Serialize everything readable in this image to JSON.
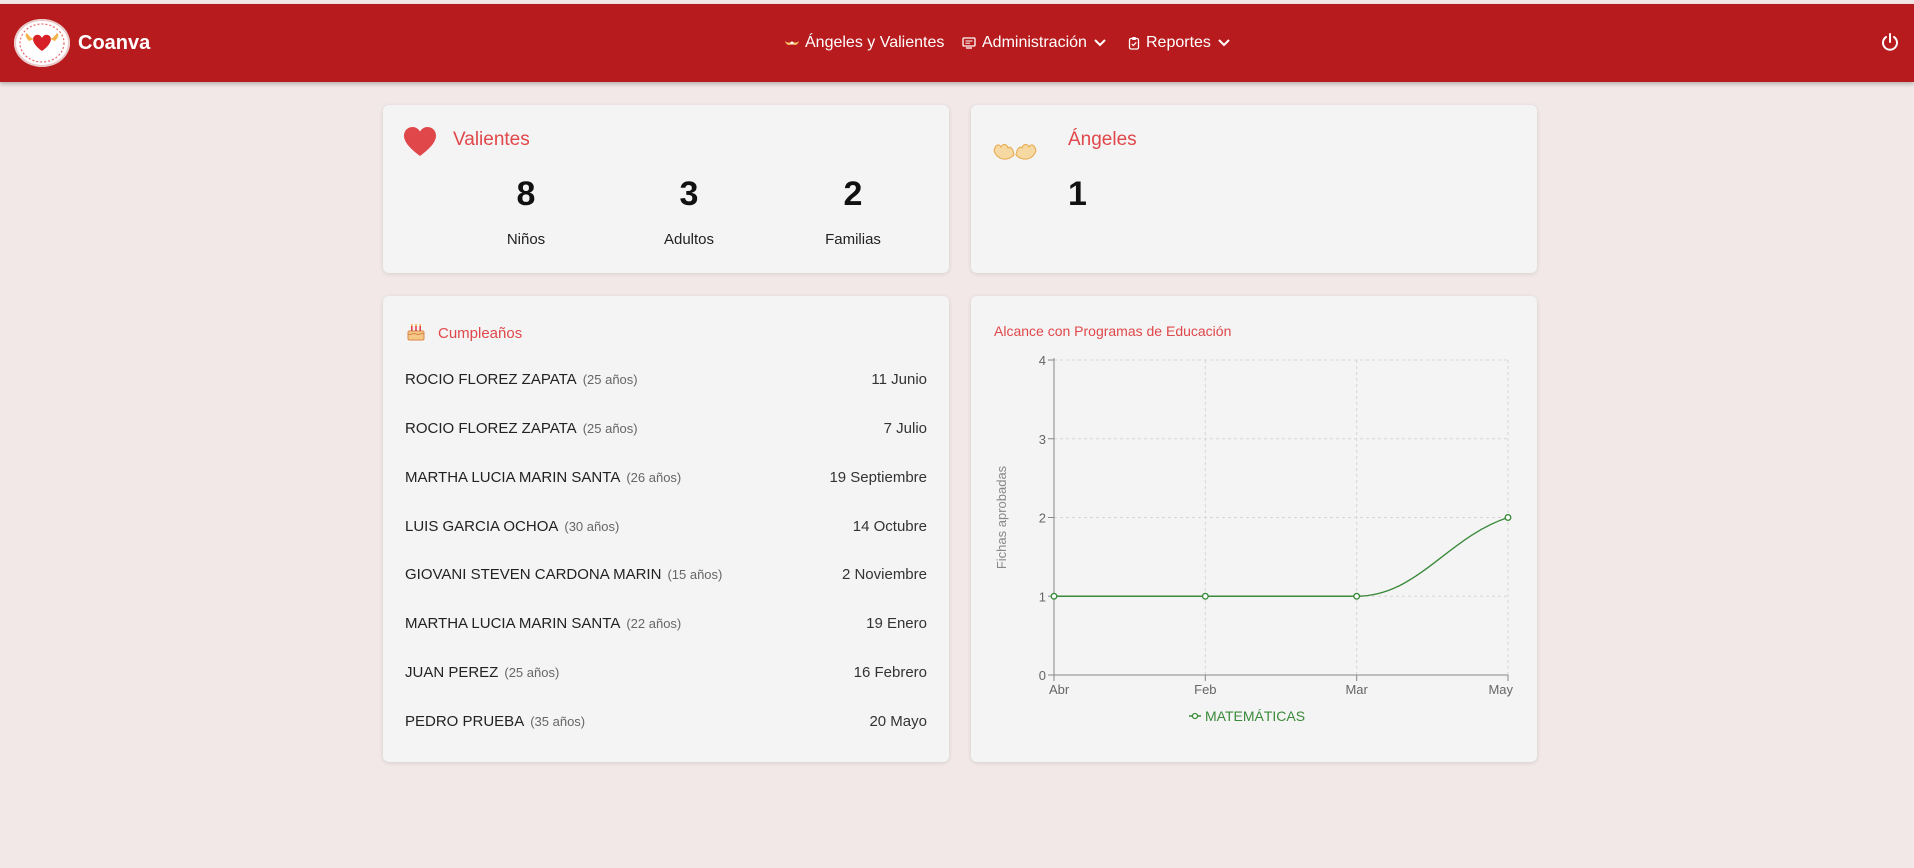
{
  "brand": {
    "name": "Coanva"
  },
  "nav": {
    "angeles_valientes": "Ángeles y Valientes",
    "administracion": "Administración",
    "reportes": "Reportes"
  },
  "colors": {
    "topbar": "#b81b1e",
    "accent": "#e0474a",
    "series_green": "#3a8a3a"
  },
  "valientes": {
    "title": "Valientes",
    "stats": [
      {
        "value": "8",
        "label": "Niños"
      },
      {
        "value": "3",
        "label": "Adultos"
      },
      {
        "value": "2",
        "label": "Familias"
      }
    ]
  },
  "angeles": {
    "title": "Ángeles",
    "value": "1"
  },
  "birthdays": {
    "title": "Cumpleaños",
    "items": [
      {
        "name": "ROCIO FLOREZ ZAPATA",
        "age": "(25 años)",
        "date": "11 Junio"
      },
      {
        "name": "ROCIO FLOREZ ZAPATA",
        "age": "(25 años)",
        "date": "7 Julio"
      },
      {
        "name": "MARTHA LUCIA MARIN SANTA",
        "age": "(26 años)",
        "date": "19 Septiembre"
      },
      {
        "name": "LUIS GARCIA OCHOA",
        "age": "(30 años)",
        "date": "14 Octubre"
      },
      {
        "name": "GIOVANI STEVEN CARDONA MARIN",
        "age": "(15 años)",
        "date": "2 Noviembre"
      },
      {
        "name": "MARTHA LUCIA MARIN SANTA",
        "age": "(22 años)",
        "date": "19 Enero"
      },
      {
        "name": "JUAN PEREZ",
        "age": "(25 años)",
        "date": "16 Febrero"
      },
      {
        "name": "PEDRO PRUEBA",
        "age": "(35 años)",
        "date": "20 Mayo"
      }
    ]
  },
  "chart_data": {
    "type": "line",
    "title": "Alcance con Programas de Educación",
    "xlabel": "",
    "ylabel": "Fichas aprobadas",
    "categories": [
      "Abr",
      "Feb",
      "Mar",
      "May"
    ],
    "series": [
      {
        "name": "MATEMÁTICAS",
        "values": [
          1,
          1,
          1,
          2
        ]
      }
    ],
    "ylim": [
      0,
      4
    ],
    "yticks": [
      "0",
      "1",
      "2",
      "3",
      "4"
    ],
    "grid": true,
    "legend": "bottom"
  }
}
